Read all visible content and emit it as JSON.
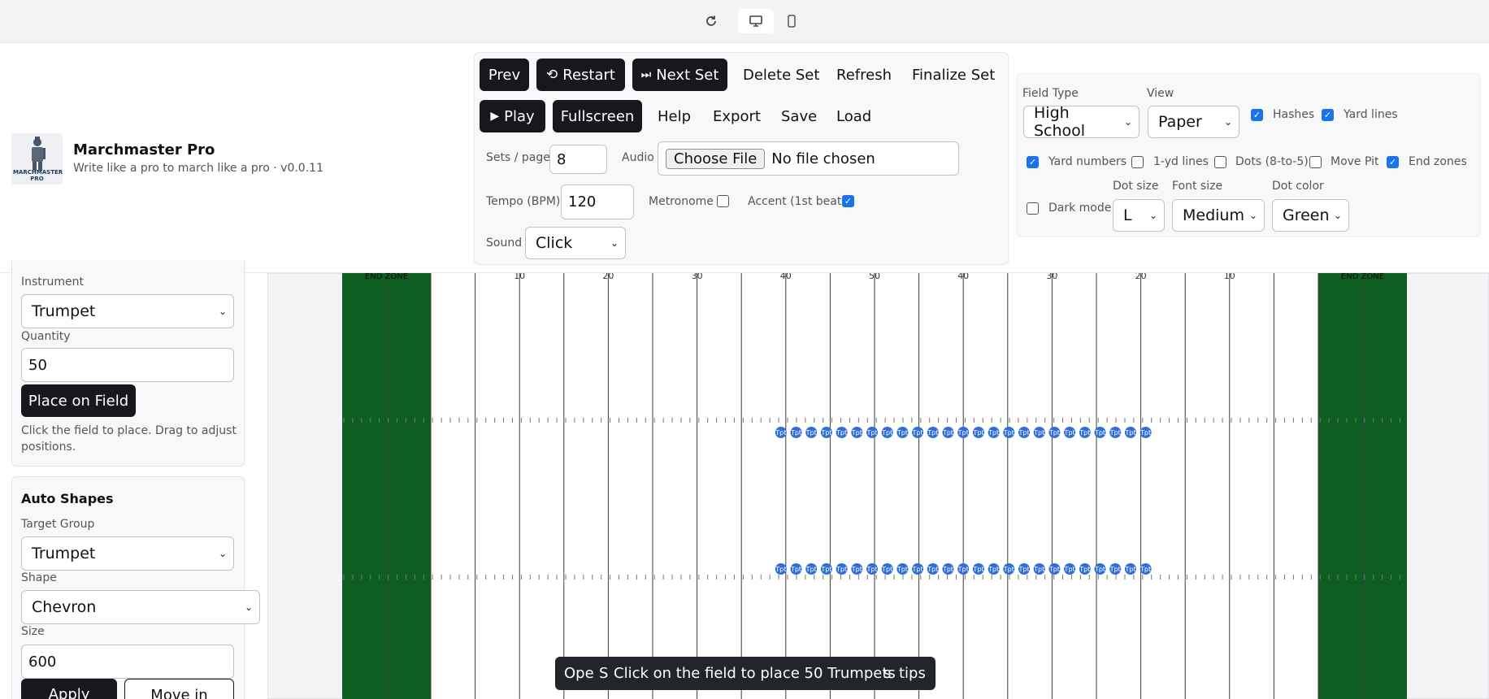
{
  "app": {
    "title": "Marchmaster Pro",
    "subtitle": "Write like a pro to march like a pro · v0.0.11",
    "logo_text": "MARCHMASTER PRO"
  },
  "topbar": {
    "icons": [
      "refresh-icon",
      "desktop-icon",
      "mobile-icon"
    ]
  },
  "controls": {
    "prev": "Prev",
    "restart": "Restart",
    "next_set": "Next Set",
    "delete_set": "Delete Set",
    "refresh": "Refresh",
    "finalize_set": "Finalize Set",
    "play": "Play",
    "fullscreen": "Fullscreen",
    "help": "Help",
    "export": "Export",
    "save": "Save",
    "load": "Load",
    "sets_per_page_label": "Sets / page",
    "sets_per_page_value": "8",
    "audio_label": "Audio",
    "choose_file": "Choose File",
    "no_file": "No file chosen",
    "tempo_label": "Tempo (BPM)",
    "tempo_value": "120",
    "metronome_label": "Metronome",
    "metronome_checked": false,
    "accent_label": "Accent (1st beat)",
    "accent_checked": true,
    "sound_label": "Sound",
    "sound_value": "Click"
  },
  "settings": {
    "field_type_label": "Field Type",
    "field_type_value": "High School",
    "view_label": "View",
    "view_value": "Paper",
    "hashes_label": "Hashes",
    "hashes_checked": true,
    "yard_lines_label": "Yard lines",
    "yard_lines_checked": true,
    "yard_numbers_label": "Yard numbers",
    "yard_numbers_checked": true,
    "one_yd_lines_label": "1-yd lines",
    "one_yd_lines_checked": false,
    "dots_label": "Dots (8-to-5)",
    "dots_checked": false,
    "move_pit_label": "Move Pit",
    "move_pit_checked": false,
    "end_zones_label": "End zones",
    "end_zones_checked": true,
    "dark_mode_label": "Dark mode",
    "dark_mode_checked": false,
    "dot_size_label": "Dot size",
    "dot_size_value": "L",
    "font_size_label": "Font size",
    "font_size_value": "Medium",
    "dot_color_label": "Dot color",
    "dot_color_value": "Green"
  },
  "left_panel": {
    "instrument_label": "Instrument",
    "instrument_value": "Trumpet",
    "quantity_label": "Quantity",
    "quantity_value": "50",
    "place_button": "Place on Field",
    "place_hint": "Click the field to place. Drag to adjust positions.",
    "auto_shapes_title": "Auto Shapes",
    "target_group_label": "Target Group",
    "target_group_value": "Trumpet",
    "shape_label": "Shape",
    "shape_value": "Chevron",
    "size_label": "Size",
    "size_value": "600",
    "apply_button": "Apply",
    "move_in_button": "Move in"
  },
  "field": {
    "end_zone_label": "END ZONE",
    "yard_numbers": [
      "10",
      "20",
      "30",
      "40",
      "50",
      "40",
      "30",
      "20",
      "10"
    ],
    "end_zone_color": "#0f5f23",
    "dot_color": "#2f6fd6",
    "dot_label": "Tpt"
  },
  "toast": {
    "message": "Click on the field to place 50 Trumpets",
    "behind_left": "Ope",
    "behind_mid": "S",
    "behind_s": "s",
    "behind_right": "tips"
  }
}
